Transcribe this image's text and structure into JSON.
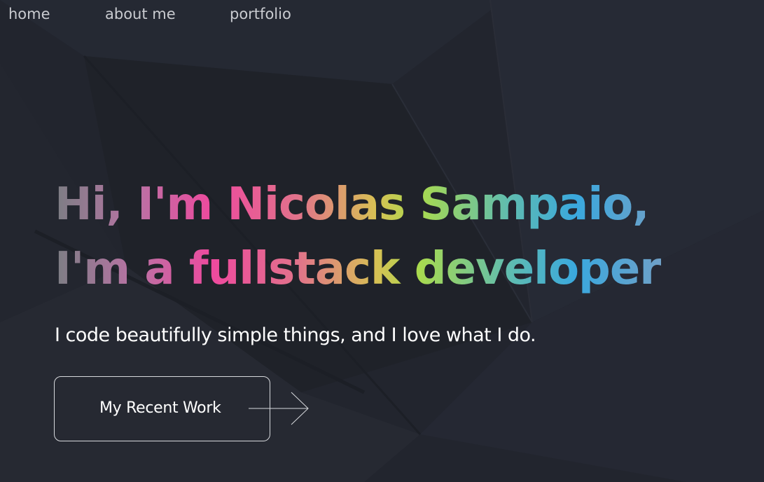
{
  "nav": {
    "items": [
      {
        "label": "home"
      },
      {
        "label": "about me"
      },
      {
        "label": "portfolio"
      }
    ]
  },
  "hero": {
    "line1": "Hi, I'm Nicolas Sampaio,",
    "line2": "I'm a fullstack developer",
    "subtitle": "I code beautifully simple things, and I love what I do.",
    "cta_label": "My Recent Work",
    "cta_icon": "arrow-right-icon"
  },
  "colors": {
    "background": "#22252e",
    "gradient": [
      "#7c7e84",
      "#ee4a9e",
      "#d7c054",
      "#a9da4e",
      "#3aa8de"
    ],
    "text": "#ffffff"
  }
}
